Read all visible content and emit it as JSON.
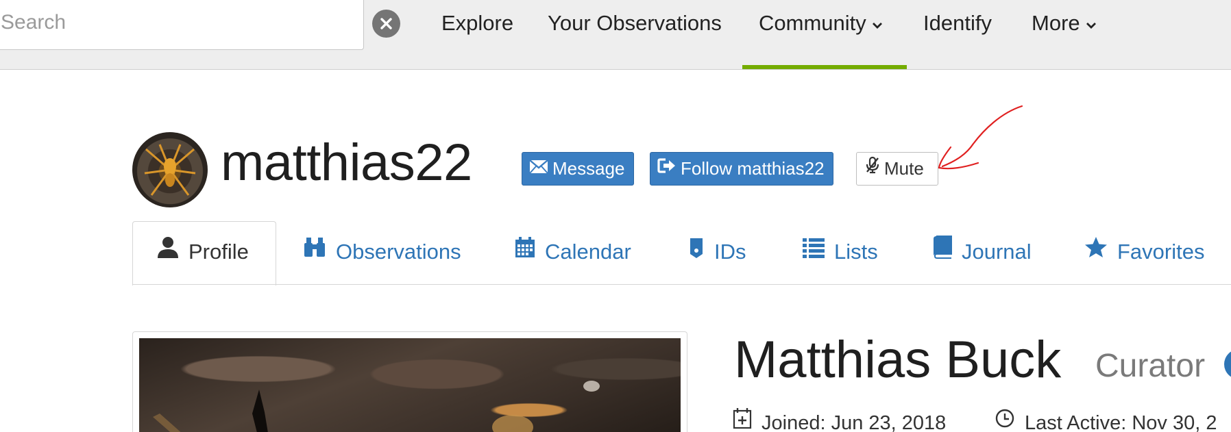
{
  "search": {
    "placeholder": "Search"
  },
  "nav": {
    "explore": "Explore",
    "your_observations": "Your Observations",
    "community": "Community",
    "identify": "Identify",
    "more": "More",
    "active_item": "Community",
    "accent_color": "#74ac00"
  },
  "profile": {
    "username": "matthias22",
    "message_label": "Message",
    "follow_label": "Follow matthias22",
    "mute_label": "Mute",
    "full_name": "Matthias Buck",
    "role": "Curator",
    "joined": "Joined: Jun 23, 2018",
    "last_active": "Last Active: Nov 30, 2"
  },
  "tabs": [
    {
      "label": "Profile",
      "icon": "person-icon",
      "active": true
    },
    {
      "label": "Observations",
      "icon": "binoculars-icon",
      "active": false
    },
    {
      "label": "Calendar",
      "icon": "calendar-icon",
      "active": false
    },
    {
      "label": "IDs",
      "icon": "tag-icon",
      "active": false
    },
    {
      "label": "Lists",
      "icon": "list-icon",
      "active": false
    },
    {
      "label": "Journal",
      "icon": "book-icon",
      "active": false
    },
    {
      "label": "Favorites",
      "icon": "star-icon",
      "active": false
    }
  ],
  "colors": {
    "primary": "#3a7ec2",
    "link": "#2e75b6",
    "annotation": "#e02020"
  }
}
